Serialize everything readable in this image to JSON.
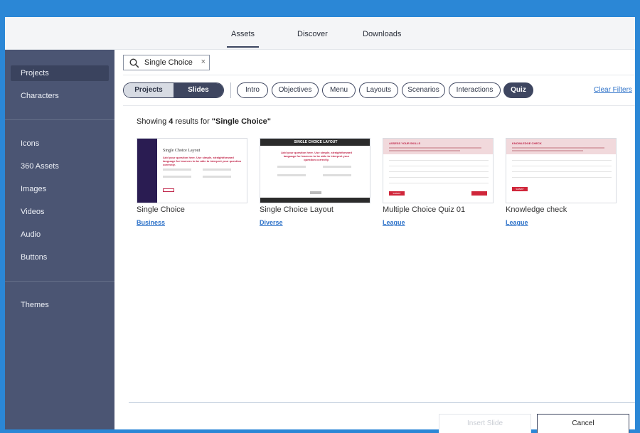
{
  "topnav": {
    "tabs": [
      {
        "label": "Assets",
        "active": true
      },
      {
        "label": "Discover",
        "active": false
      },
      {
        "label": "Downloads",
        "active": false
      }
    ]
  },
  "sidebar": {
    "items": [
      {
        "label": "Projects",
        "active": true
      },
      {
        "label": "Characters"
      },
      {
        "label": "Icons"
      },
      {
        "label": "360 Assets"
      },
      {
        "label": "Images"
      },
      {
        "label": "Videos"
      },
      {
        "label": "Audio"
      },
      {
        "label": "Buttons"
      },
      {
        "label": "Themes"
      }
    ]
  },
  "search": {
    "value": "Single Choice",
    "clear_glyph": "×",
    "icon": "search-icon"
  },
  "segment": {
    "left": "Projects",
    "right": "Slides",
    "selected": "Slides"
  },
  "filters": {
    "chips": [
      {
        "label": "Intro"
      },
      {
        "label": "Objectives"
      },
      {
        "label": "Menu"
      },
      {
        "label": "Layouts"
      },
      {
        "label": "Scenarios"
      },
      {
        "label": "Interactions"
      },
      {
        "label": "Quiz",
        "active": true
      }
    ],
    "clear_label": "Clear Filters"
  },
  "results": {
    "prefix": "Showing ",
    "count": "4",
    "middle": " results for ",
    "query": "\"Single Choice\"",
    "cards": [
      {
        "title": "Single Choice",
        "category": "Business",
        "thumb": {
          "heading": "Single Choice Layout",
          "question": "Add your question here. Use simple, straightforward language for learners to be able to interpret your question correctly."
        }
      },
      {
        "title": "Single Choice Layout",
        "category": "Diverse",
        "thumb": {
          "heading": "SINGLE CHOICE LAYOUT",
          "question": "Add your question here. Use simple, straightforward language for learners to be able to interpret your question correctly."
        }
      },
      {
        "title": "Multiple Choice Quiz 01",
        "category": "League",
        "thumb": {
          "heading": "ASSESS YOUR SKILLS",
          "button": "SUBMIT"
        }
      },
      {
        "title": "Knowledge check",
        "category": "League",
        "thumb": {
          "heading": "KNOWLEDGE CHECK",
          "button": "SUBMIT"
        }
      }
    ]
  },
  "footer": {
    "insert_label": "Insert Slide",
    "cancel_label": "Cancel"
  },
  "colors": {
    "accent": "#3e4660",
    "sidebar": "#4b5573",
    "link": "#2f73c9",
    "brand_red": "#d0263a",
    "frame_blue": "#2b87d6"
  }
}
